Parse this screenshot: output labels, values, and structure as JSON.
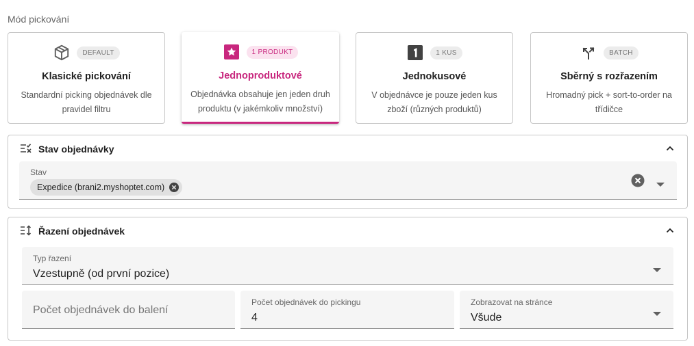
{
  "mode_section": {
    "label": "Mód pickování",
    "cards": [
      {
        "badge": "DEFAULT",
        "title": "Klasické pickování",
        "description": "Standardní picking objednávek dle pravidel filtru",
        "icon": "box-icon",
        "active": false
      },
      {
        "badge": "1 PRODUKT",
        "title": "Jednoproduktové",
        "description": "Objednávka obsahuje jen jeden druh produktu (v jakémkoliv množství)",
        "icon": "star-icon",
        "active": true
      },
      {
        "badge": "1 KUS",
        "title": "Jednokusové",
        "description": "V objednávce je pouze jeden kus zboží (různých produktů)",
        "icon": "numeric-1-icon",
        "active": false
      },
      {
        "badge": "BATCH",
        "title": "Sběrný s rozřazením",
        "description": "Hromadný pick + sort-to-order na třídičce",
        "icon": "call-split-icon",
        "active": false
      }
    ]
  },
  "status_panel": {
    "title": "Stav objednávky",
    "field_label": "Stav",
    "chips": [
      "Expedice (brani2.myshoptet.com)"
    ]
  },
  "sort_panel": {
    "title": "Řazení objednávek",
    "sort_type": {
      "label": "Typ řazení",
      "value": "Vzestupně (od první pozice)"
    },
    "pack_count": {
      "placeholder": "Počet objednávek do balení"
    },
    "picking_count": {
      "label": "Počet objednávek do pickingu",
      "value": "4"
    },
    "per_page": {
      "label": "Zobrazovat na stránce",
      "value": "Všude"
    }
  },
  "colors": {
    "accent": "#c8277e",
    "badge_pink_bg": "#fbe2ef",
    "field_bg": "#f5f5f5"
  }
}
